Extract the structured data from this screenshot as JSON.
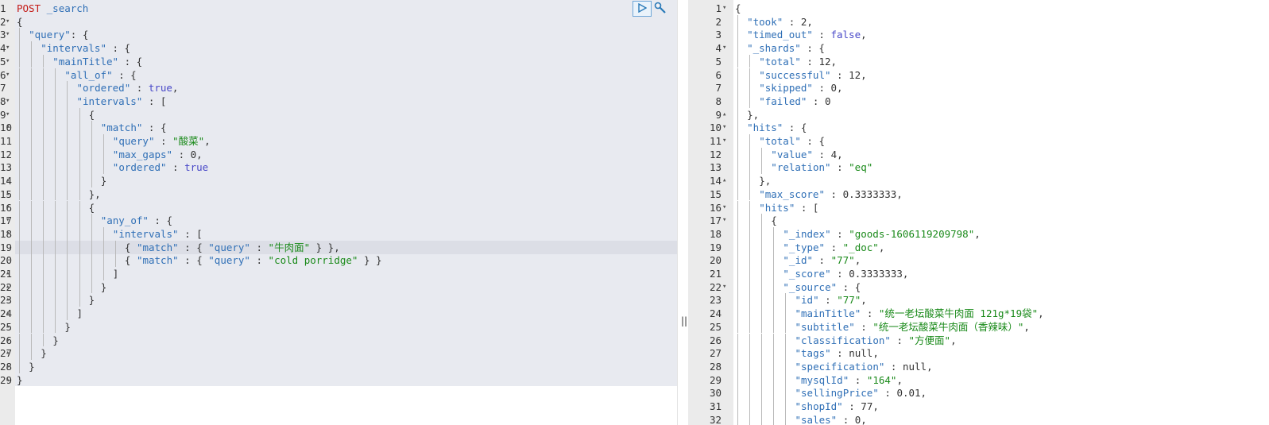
{
  "request": {
    "method": "POST",
    "path": "_search",
    "highlighted_line": 19,
    "lines": [
      {
        "n": "1",
        "fold": "",
        "indent": 0,
        "tokens": [
          [
            "method",
            "POST"
          ],
          [
            "punct",
            " "
          ],
          [
            "path",
            "_search"
          ]
        ]
      },
      {
        "n": "2",
        "fold": "▾",
        "indent": 0,
        "tokens": [
          [
            "punct",
            "{"
          ]
        ]
      },
      {
        "n": "3",
        "fold": "▾",
        "indent": 1,
        "tokens": [
          [
            "key",
            "\"query\""
          ],
          [
            "punct",
            ": {"
          ]
        ]
      },
      {
        "n": "4",
        "fold": "▾",
        "indent": 2,
        "tokens": [
          [
            "key",
            "\"intervals\""
          ],
          [
            "punct",
            " : {"
          ]
        ]
      },
      {
        "n": "5",
        "fold": "▾",
        "indent": 3,
        "tokens": [
          [
            "key",
            "\"mainTitle\""
          ],
          [
            "punct",
            " : {"
          ]
        ]
      },
      {
        "n": "6",
        "fold": "▾",
        "indent": 4,
        "tokens": [
          [
            "key",
            "\"all_of\""
          ],
          [
            "punct",
            " : {"
          ]
        ]
      },
      {
        "n": "7",
        "fold": "",
        "indent": 5,
        "tokens": [
          [
            "key",
            "\"ordered\""
          ],
          [
            "punct",
            " : "
          ],
          [
            "kw",
            "true"
          ],
          [
            "punct",
            ","
          ]
        ]
      },
      {
        "n": "8",
        "fold": "▾",
        "indent": 5,
        "tokens": [
          [
            "key",
            "\"intervals\""
          ],
          [
            "punct",
            " : ["
          ]
        ]
      },
      {
        "n": "9",
        "fold": "▾",
        "indent": 6,
        "tokens": [
          [
            "punct",
            "{"
          ]
        ]
      },
      {
        "n": "10",
        "fold": "▾",
        "indent": 7,
        "tokens": [
          [
            "key",
            "\"match\""
          ],
          [
            "punct",
            " : {"
          ]
        ]
      },
      {
        "n": "11",
        "fold": "",
        "indent": 8,
        "tokens": [
          [
            "key",
            "\"query\""
          ],
          [
            "punct",
            " : "
          ],
          [
            "str",
            "\"酸菜\""
          ],
          [
            "punct",
            ","
          ]
        ]
      },
      {
        "n": "12",
        "fold": "",
        "indent": 8,
        "tokens": [
          [
            "key",
            "\"max_gaps\""
          ],
          [
            "punct",
            " : "
          ],
          [
            "num",
            "0"
          ],
          [
            "punct",
            ","
          ]
        ]
      },
      {
        "n": "13",
        "fold": "",
        "indent": 8,
        "tokens": [
          [
            "key",
            "\"ordered\""
          ],
          [
            "punct",
            " : "
          ],
          [
            "kw",
            "true"
          ]
        ]
      },
      {
        "n": "14",
        "fold": "▴",
        "indent": 7,
        "tokens": [
          [
            "punct",
            "}"
          ]
        ]
      },
      {
        "n": "15",
        "fold": "▴",
        "indent": 6,
        "tokens": [
          [
            "punct",
            "},"
          ]
        ]
      },
      {
        "n": "16",
        "fold": "▾",
        "indent": 6,
        "tokens": [
          [
            "punct",
            "{"
          ]
        ]
      },
      {
        "n": "17",
        "fold": "▾",
        "indent": 7,
        "tokens": [
          [
            "key",
            "\"any_of\""
          ],
          [
            "punct",
            " : {"
          ]
        ]
      },
      {
        "n": "18",
        "fold": "▾",
        "indent": 8,
        "tokens": [
          [
            "key",
            "\"intervals\""
          ],
          [
            "punct",
            " : ["
          ]
        ]
      },
      {
        "n": "19",
        "fold": "",
        "indent": 9,
        "tokens": [
          [
            "punct",
            "{ "
          ],
          [
            "key",
            "\"match\""
          ],
          [
            "punct",
            " : { "
          ],
          [
            "key",
            "\"query\""
          ],
          [
            "punct",
            " : "
          ],
          [
            "str",
            "\"牛肉面\""
          ],
          [
            "punct",
            " } },"
          ]
        ]
      },
      {
        "n": "20",
        "fold": "",
        "indent": 9,
        "tokens": [
          [
            "punct",
            "{ "
          ],
          [
            "key",
            "\"match\""
          ],
          [
            "punct",
            " : { "
          ],
          [
            "key",
            "\"query\""
          ],
          [
            "punct",
            " : "
          ],
          [
            "str",
            "\"cold porridge\""
          ],
          [
            "punct",
            " } }"
          ]
        ]
      },
      {
        "n": "21",
        "fold": "▴",
        "indent": 8,
        "tokens": [
          [
            "punct",
            "]"
          ]
        ]
      },
      {
        "n": "22",
        "fold": "▴",
        "indent": 7,
        "tokens": [
          [
            "punct",
            "}"
          ]
        ]
      },
      {
        "n": "23",
        "fold": "▴",
        "indent": 6,
        "tokens": [
          [
            "punct",
            "}"
          ]
        ]
      },
      {
        "n": "24",
        "fold": "▴",
        "indent": 5,
        "tokens": [
          [
            "punct",
            "]"
          ]
        ]
      },
      {
        "n": "25",
        "fold": "▴",
        "indent": 4,
        "tokens": [
          [
            "punct",
            "}"
          ]
        ]
      },
      {
        "n": "26",
        "fold": "▴",
        "indent": 3,
        "tokens": [
          [
            "punct",
            "}"
          ]
        ]
      },
      {
        "n": "27",
        "fold": "▴",
        "indent": 2,
        "tokens": [
          [
            "punct",
            "}"
          ]
        ]
      },
      {
        "n": "28",
        "fold": "▴",
        "indent": 1,
        "tokens": [
          [
            "punct",
            "}"
          ]
        ]
      },
      {
        "n": "29",
        "fold": "▴",
        "indent": 0,
        "tokens": [
          [
            "punct",
            "}"
          ]
        ]
      }
    ]
  },
  "toolbar": {
    "run_icon": "play-icon",
    "settings_icon": "wrench-icon"
  },
  "divider": {
    "grip": "||"
  },
  "response": {
    "lines": [
      {
        "n": "1",
        "fold": "▾",
        "indent": 0,
        "tokens": [
          [
            "punct",
            "{"
          ]
        ]
      },
      {
        "n": "2",
        "fold": "",
        "indent": 1,
        "tokens": [
          [
            "key",
            "\"took\""
          ],
          [
            "punct",
            " : "
          ],
          [
            "num",
            "2"
          ],
          [
            "punct",
            ","
          ]
        ]
      },
      {
        "n": "3",
        "fold": "",
        "indent": 1,
        "tokens": [
          [
            "key",
            "\"timed_out\""
          ],
          [
            "punct",
            " : "
          ],
          [
            "kw",
            "false"
          ],
          [
            "punct",
            ","
          ]
        ]
      },
      {
        "n": "4",
        "fold": "▾",
        "indent": 1,
        "tokens": [
          [
            "key",
            "\"_shards\""
          ],
          [
            "punct",
            " : {"
          ]
        ]
      },
      {
        "n": "5",
        "fold": "",
        "indent": 2,
        "tokens": [
          [
            "key",
            "\"total\""
          ],
          [
            "punct",
            " : "
          ],
          [
            "num",
            "12"
          ],
          [
            "punct",
            ","
          ]
        ]
      },
      {
        "n": "6",
        "fold": "",
        "indent": 2,
        "tokens": [
          [
            "key",
            "\"successful\""
          ],
          [
            "punct",
            " : "
          ],
          [
            "num",
            "12"
          ],
          [
            "punct",
            ","
          ]
        ]
      },
      {
        "n": "7",
        "fold": "",
        "indent": 2,
        "tokens": [
          [
            "key",
            "\"skipped\""
          ],
          [
            "punct",
            " : "
          ],
          [
            "num",
            "0"
          ],
          [
            "punct",
            ","
          ]
        ]
      },
      {
        "n": "8",
        "fold": "",
        "indent": 2,
        "tokens": [
          [
            "key",
            "\"failed\""
          ],
          [
            "punct",
            " : "
          ],
          [
            "num",
            "0"
          ]
        ]
      },
      {
        "n": "9",
        "fold": "▴",
        "indent": 1,
        "tokens": [
          [
            "punct",
            "},"
          ]
        ]
      },
      {
        "n": "10",
        "fold": "▾",
        "indent": 1,
        "tokens": [
          [
            "key",
            "\"hits\""
          ],
          [
            "punct",
            " : {"
          ]
        ]
      },
      {
        "n": "11",
        "fold": "▾",
        "indent": 2,
        "tokens": [
          [
            "key",
            "\"total\""
          ],
          [
            "punct",
            " : {"
          ]
        ]
      },
      {
        "n": "12",
        "fold": "",
        "indent": 3,
        "tokens": [
          [
            "key",
            "\"value\""
          ],
          [
            "punct",
            " : "
          ],
          [
            "num",
            "4"
          ],
          [
            "punct",
            ","
          ]
        ]
      },
      {
        "n": "13",
        "fold": "",
        "indent": 3,
        "tokens": [
          [
            "key",
            "\"relation\""
          ],
          [
            "punct",
            " : "
          ],
          [
            "str",
            "\"eq\""
          ]
        ]
      },
      {
        "n": "14",
        "fold": "▴",
        "indent": 2,
        "tokens": [
          [
            "punct",
            "},"
          ]
        ]
      },
      {
        "n": "15",
        "fold": "",
        "indent": 2,
        "tokens": [
          [
            "key",
            "\"max_score\""
          ],
          [
            "punct",
            " : "
          ],
          [
            "num",
            "0.3333333"
          ],
          [
            "punct",
            ","
          ]
        ]
      },
      {
        "n": "16",
        "fold": "▾",
        "indent": 2,
        "tokens": [
          [
            "key",
            "\"hits\""
          ],
          [
            "punct",
            " : ["
          ]
        ]
      },
      {
        "n": "17",
        "fold": "▾",
        "indent": 3,
        "tokens": [
          [
            "punct",
            "{"
          ]
        ]
      },
      {
        "n": "18",
        "fold": "",
        "indent": 4,
        "tokens": [
          [
            "key",
            "\"_index\""
          ],
          [
            "punct",
            " : "
          ],
          [
            "str",
            "\"goods-1606119209798\""
          ],
          [
            "punct",
            ","
          ]
        ]
      },
      {
        "n": "19",
        "fold": "",
        "indent": 4,
        "tokens": [
          [
            "key",
            "\"_type\""
          ],
          [
            "punct",
            " : "
          ],
          [
            "str",
            "\"_doc\""
          ],
          [
            "punct",
            ","
          ]
        ]
      },
      {
        "n": "20",
        "fold": "",
        "indent": 4,
        "tokens": [
          [
            "key",
            "\"_id\""
          ],
          [
            "punct",
            " : "
          ],
          [
            "str",
            "\"77\""
          ],
          [
            "punct",
            ","
          ]
        ]
      },
      {
        "n": "21",
        "fold": "",
        "indent": 4,
        "tokens": [
          [
            "key",
            "\"_score\""
          ],
          [
            "punct",
            " : "
          ],
          [
            "num",
            "0.3333333"
          ],
          [
            "punct",
            ","
          ]
        ]
      },
      {
        "n": "22",
        "fold": "▾",
        "indent": 4,
        "tokens": [
          [
            "key",
            "\"_source\""
          ],
          [
            "punct",
            " : {"
          ]
        ]
      },
      {
        "n": "23",
        "fold": "",
        "indent": 5,
        "tokens": [
          [
            "key",
            "\"id\""
          ],
          [
            "punct",
            " : "
          ],
          [
            "str",
            "\"77\""
          ],
          [
            "punct",
            ","
          ]
        ]
      },
      {
        "n": "24",
        "fold": "",
        "indent": 5,
        "tokens": [
          [
            "key",
            "\"mainTitle\""
          ],
          [
            "punct",
            " : "
          ],
          [
            "str",
            "\"统一老坛酸菜牛肉面 121g*19袋\""
          ],
          [
            "punct",
            ","
          ]
        ]
      },
      {
        "n": "25",
        "fold": "",
        "indent": 5,
        "tokens": [
          [
            "key",
            "\"subtitle\""
          ],
          [
            "punct",
            " : "
          ],
          [
            "str",
            "\"统一老坛酸菜牛肉面（香辣味）\""
          ],
          [
            "punct",
            ","
          ]
        ]
      },
      {
        "n": "26",
        "fold": "",
        "indent": 5,
        "tokens": [
          [
            "key",
            "\"classification\""
          ],
          [
            "punct",
            " : "
          ],
          [
            "str",
            "\"方便面\""
          ],
          [
            "punct",
            ","
          ]
        ]
      },
      {
        "n": "27",
        "fold": "",
        "indent": 5,
        "tokens": [
          [
            "key",
            "\"tags\""
          ],
          [
            "punct",
            " : "
          ],
          [
            "num",
            "null"
          ],
          [
            "punct",
            ","
          ]
        ]
      },
      {
        "n": "28",
        "fold": "",
        "indent": 5,
        "tokens": [
          [
            "key",
            "\"specification\""
          ],
          [
            "punct",
            " : "
          ],
          [
            "num",
            "null"
          ],
          [
            "punct",
            ","
          ]
        ]
      },
      {
        "n": "29",
        "fold": "",
        "indent": 5,
        "tokens": [
          [
            "key",
            "\"mysqlId\""
          ],
          [
            "punct",
            " : "
          ],
          [
            "str",
            "\"164\""
          ],
          [
            "punct",
            ","
          ]
        ]
      },
      {
        "n": "30",
        "fold": "",
        "indent": 5,
        "tokens": [
          [
            "key",
            "\"sellingPrice\""
          ],
          [
            "punct",
            " : "
          ],
          [
            "num",
            "0.01"
          ],
          [
            "punct",
            ","
          ]
        ]
      },
      {
        "n": "31",
        "fold": "",
        "indent": 5,
        "tokens": [
          [
            "key",
            "\"shopId\""
          ],
          [
            "punct",
            " : "
          ],
          [
            "num",
            "77"
          ],
          [
            "punct",
            ","
          ]
        ]
      },
      {
        "n": "32",
        "fold": "",
        "indent": 5,
        "tokens": [
          [
            "key",
            "\"sales\""
          ],
          [
            "punct",
            " : "
          ],
          [
            "num",
            "0"
          ],
          [
            "punct",
            ","
          ]
        ]
      }
    ]
  }
}
